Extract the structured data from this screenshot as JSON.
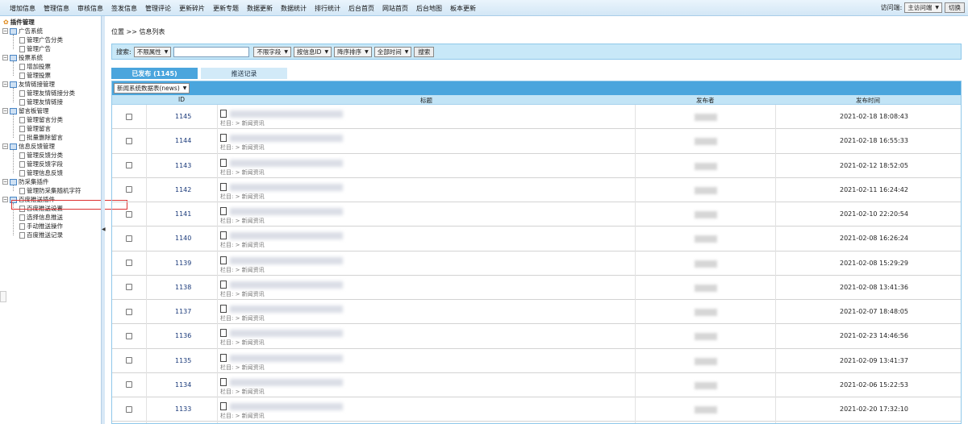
{
  "topnav": {
    "items": [
      "增加信息",
      "管理信息",
      "审核信息",
      "签发信息",
      "管理评论",
      "更新碎片",
      "更新专题",
      "数据更新",
      "数据统计",
      "排行统计",
      "后台首页",
      "网站首页",
      "后台地图",
      "板本更新"
    ],
    "site_label": "访问端:",
    "site_value": "主访问端",
    "switch_label": "切换"
  },
  "sidebar": {
    "root": "插件管理",
    "groups": [
      {
        "label": "广告系统",
        "items": [
          "管理广告分类",
          "管理广告"
        ]
      },
      {
        "label": "投票系统",
        "items": [
          "增加投票",
          "管理投票"
        ]
      },
      {
        "label": "友情链接管理",
        "items": [
          "管理友情链接分类",
          "管理友情链接"
        ]
      },
      {
        "label": "留言板管理",
        "items": [
          "管理留言分类",
          "管理留言",
          "批量删除留言"
        ]
      },
      {
        "label": "信息反馈管理",
        "items": [
          "管理反馈分类",
          "管理反馈字段",
          "管理信息反馈"
        ]
      },
      {
        "label": "防采集插件",
        "items": [
          "管理防采集随机字符"
        ]
      },
      {
        "label": "百度推送插件",
        "items": [
          "百度推送设置",
          "选择信息推送",
          "手动推送操作",
          "百度推送记录"
        ]
      }
    ]
  },
  "breadcrumb": "位置 >> 信息列表",
  "search": {
    "label": "搜索:",
    "attr_select": "不限属性",
    "field_select": "不限字段",
    "order_by_select": "按信息ID",
    "sort_select": "降序排序",
    "time_select": "全部时间",
    "button": "搜索"
  },
  "tabs": [
    {
      "label": "已发布 (1145)",
      "active": true
    },
    {
      "label": "推送记录",
      "active": false
    }
  ],
  "table": {
    "table_select": "新闻系统数据表(news)",
    "columns": [
      "ID",
      "标题",
      "发布者",
      "发布时间"
    ],
    "category": "栏目: > 新闻资讯",
    "rows": [
      {
        "id": "1145",
        "time": "2021-02-18 18:08:43"
      },
      {
        "id": "1144",
        "time": "2021-02-18 16:55:33"
      },
      {
        "id": "1143",
        "time": "2021-02-12 18:52:05"
      },
      {
        "id": "1142",
        "time": "2021-02-11 16:24:42"
      },
      {
        "id": "1141",
        "time": "2021-02-10 22:20:54"
      },
      {
        "id": "1140",
        "time": "2021-02-08 16:26:24"
      },
      {
        "id": "1139",
        "time": "2021-02-08 15:29:29"
      },
      {
        "id": "1138",
        "time": "2021-02-08 13:41:36"
      },
      {
        "id": "1137",
        "time": "2021-02-07 18:48:05"
      },
      {
        "id": "1136",
        "time": "2021-02-23 14:46:56"
      },
      {
        "id": "1135",
        "time": "2021-02-09 13:41:37"
      },
      {
        "id": "1134",
        "time": "2021-02-06 15:22:53"
      },
      {
        "id": "1133",
        "time": "2021-02-20 17:32:10"
      }
    ]
  }
}
